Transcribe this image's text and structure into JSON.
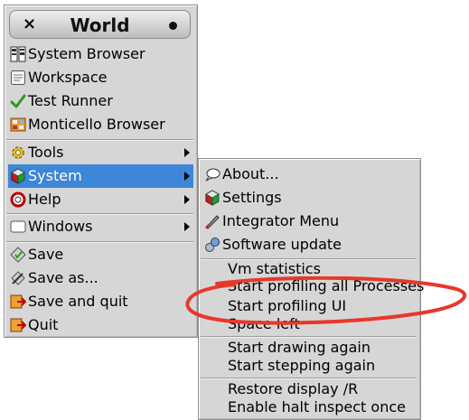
{
  "world_menu": {
    "title": "World",
    "close_glyph": "×",
    "items": [
      {
        "label": "System Browser",
        "icon": "system-browser-icon"
      },
      {
        "label": "Workspace",
        "icon": "workspace-icon"
      },
      {
        "label": "Test Runner",
        "icon": "checkmark-icon"
      },
      {
        "label": "Monticello Browser",
        "icon": "monticello-icon"
      },
      {
        "label": "Tools",
        "icon": "gear-icon",
        "submenu": true
      },
      {
        "label": "System",
        "icon": "cube-icon",
        "submenu": true,
        "selected": true
      },
      {
        "label": "Help",
        "icon": "lifebuoy-icon",
        "submenu": true
      },
      {
        "label": "Windows",
        "icon": "window-icon",
        "submenu": true
      },
      {
        "label": "Save",
        "icon": "save-icon"
      },
      {
        "label": "Save as...",
        "icon": "save-as-icon"
      },
      {
        "label": "Save and quit",
        "icon": "save-quit-icon"
      },
      {
        "label": "Quit",
        "icon": "quit-icon"
      }
    ]
  },
  "system_menu": {
    "items": [
      {
        "label": "About...",
        "icon": "speech-bubble-icon"
      },
      {
        "label": "Settings",
        "icon": "cube-icon"
      },
      {
        "label": "Integrator Menu",
        "icon": "brush-icon"
      },
      {
        "label": "Software update",
        "icon": "update-icon"
      },
      {
        "label": "Vm statistics"
      },
      {
        "label": "Start profiling all Processes"
      },
      {
        "label": "Start profiling UI"
      },
      {
        "label": "Space left"
      },
      {
        "label": "Start drawing again"
      },
      {
        "label": "Start stepping again"
      },
      {
        "label": "Restore display /R"
      },
      {
        "label": "Enable halt inspect once"
      }
    ]
  },
  "colors": {
    "menu_background": "#d6d6d6",
    "selection": "#3d86d8",
    "annotation": "#e8372a"
  }
}
